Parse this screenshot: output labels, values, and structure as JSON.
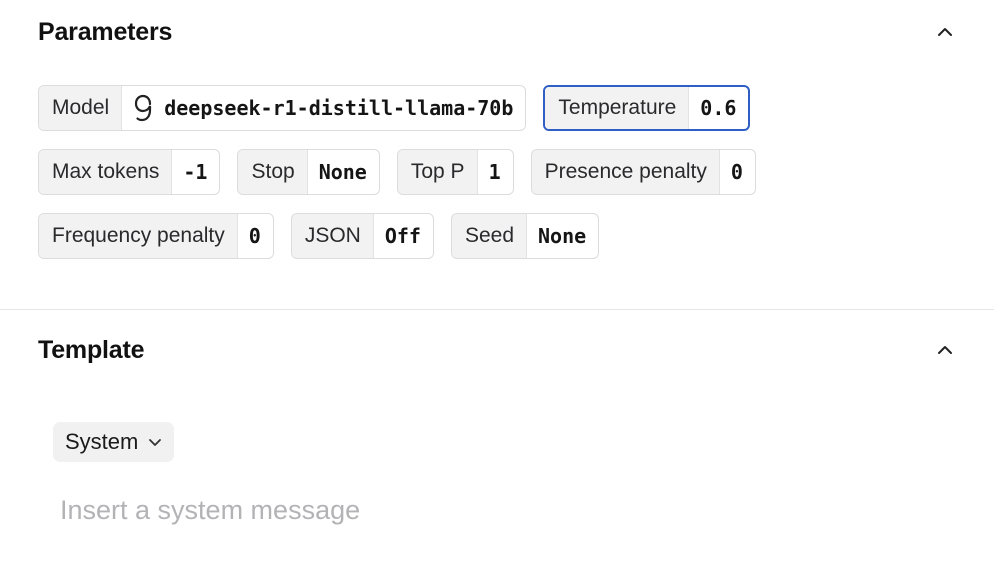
{
  "parameters": {
    "title": "Parameters",
    "rows": [
      [
        {
          "label": "Model",
          "value": "deepseek-r1-distill-llama-70b",
          "icon": "deepseek-model-icon",
          "active": false
        },
        {
          "label": "Temperature",
          "value": "0.6",
          "active": true
        }
      ],
      [
        {
          "label": "Max tokens",
          "value": "-1"
        },
        {
          "label": "Stop",
          "value": "None"
        },
        {
          "label": "Top P",
          "value": "1"
        },
        {
          "label": "Presence penalty",
          "value": "0"
        }
      ],
      [
        {
          "label": "Frequency penalty",
          "value": "0"
        },
        {
          "label": "JSON",
          "value": "Off"
        },
        {
          "label": "Seed",
          "value": "None"
        }
      ]
    ]
  },
  "template": {
    "title": "Template",
    "role": "System",
    "message_placeholder": "Insert a system message",
    "message_value": ""
  },
  "colors": {
    "accent": "#2f5fc4",
    "chip_label_bg": "#f2f2f3",
    "border": "#dcdcdf",
    "placeholder": "#b3b3b6"
  }
}
